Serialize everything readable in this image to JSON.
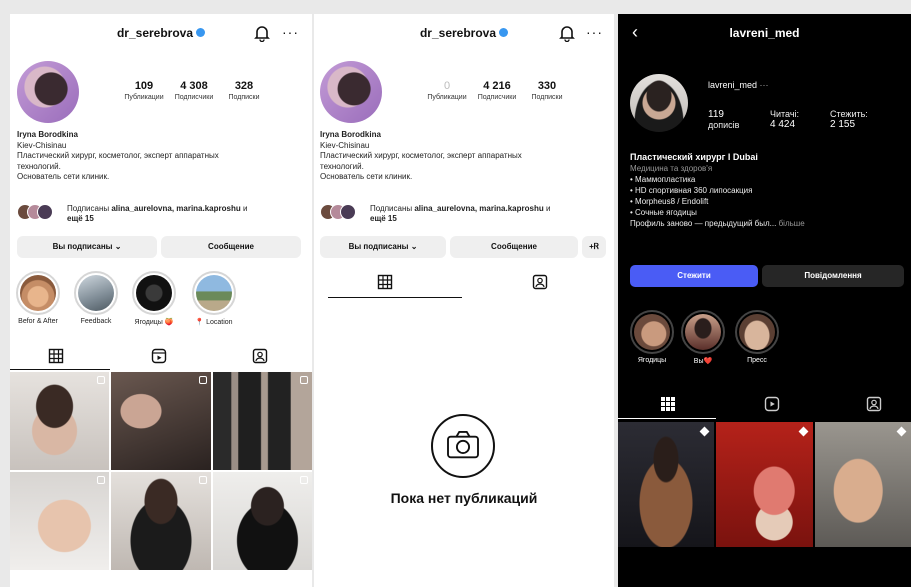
{
  "panel1": {
    "username": "dr_serebrova",
    "stats": [
      {
        "value": "109",
        "label": "Публикации"
      },
      {
        "value": "4 308",
        "label": "Подписчики"
      },
      {
        "value": "328",
        "label": "Подписки"
      }
    ],
    "name": "Iryna Borodkina",
    "location": "Kiev-Chisinau",
    "bio1": "Пластический хирург, косметолог, эксперт аппаратных",
    "bio2": "технологий.",
    "bio3": "Основатель сети клиник.",
    "followed_prefix": "Подписаны ",
    "followed_names": "alina_aurelovna, marina.kaproshu",
    "followed_suffix": " и",
    "followed_more": "ещё 15",
    "btn_subscribed": "Вы подписаны ⌄",
    "btn_message": "Сообщение",
    "highlights": [
      "Befor & After",
      "Feedback",
      "Ягодицы 🍑",
      "📍 Location"
    ]
  },
  "panel2": {
    "username": "dr_serebrova",
    "stats": [
      {
        "value": "0",
        "label": "Публикации"
      },
      {
        "value": "4 216",
        "label": "Подписчики"
      },
      {
        "value": "330",
        "label": "Подписки"
      }
    ],
    "name": "Iryna Borodkina",
    "location": "Kiev-Chisinau",
    "bio1": "Пластический хирург, косметолог, эксперт аппаратных",
    "bio2": "технологий.",
    "bio3": "Основатель сети клиник.",
    "followed_prefix": "Подписаны ",
    "followed_names": "alina_aurelovna, marina.kaproshu",
    "followed_suffix": " и",
    "followed_more": "ещё 15",
    "btn_subscribed": "Вы подписаны ⌄",
    "btn_message": "Сообщение",
    "btn_add": "+Ꮢ",
    "empty_text": "Пока нет публикаций"
  },
  "panel3": {
    "header": "lavreni_med",
    "back": "‹",
    "username": "lavreni_med",
    "more": "···",
    "stats": [
      {
        "value": "119",
        "label": "дописів"
      },
      {
        "value": "4 424",
        "label": "Читачі:"
      },
      {
        "value": "2 155",
        "label": "Стежить:"
      }
    ],
    "title": "Пластический хирург I Dubai",
    "category": "Медицина та здоров'я",
    "lines": [
      "• Маммопластика",
      "• HD спортивная 360 липосакция",
      "• Morpheus8 / Endolift",
      "• Сочные ягодицы"
    ],
    "last_line": "Профиль заново — предыдущий был...",
    "more_link": " більше",
    "btn_follow": "Стежити",
    "btn_message": "Повідомлення",
    "highlights": [
      "Ягодицы",
      "Вы❤️",
      "Пресс"
    ]
  },
  "colors": {
    "accent": "#3897f0",
    "follow_btn": "#4a5cf5",
    "dark_bg": "#000000"
  }
}
